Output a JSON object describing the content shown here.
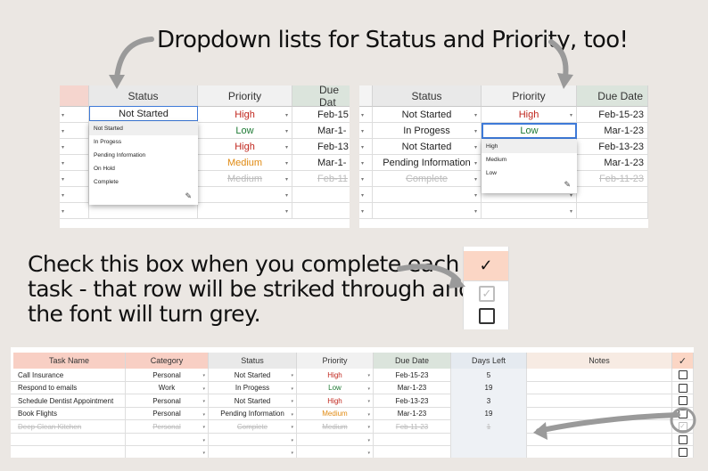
{
  "captions": {
    "top": "Dropdown lists for Status and Priority, too!",
    "middle": [
      "Check this box when you complete each",
      "task - that row will be striked through and",
      "the font will turn grey."
    ]
  },
  "status_sheet": {
    "headers": {
      "status": "Status",
      "priority": "Priority",
      "due": "Due Dat"
    },
    "active_value": "Not Started",
    "rows": [
      {
        "priority": "High",
        "due": "Feb-15"
      },
      {
        "priority": "Low",
        "due": "Mar-1-"
      },
      {
        "priority": "High",
        "due": "Feb-13"
      },
      {
        "priority": "Medium",
        "due": "Mar-1-"
      },
      {
        "priority": "Medium",
        "due": "Feb-11"
      }
    ],
    "options": [
      "Not Started",
      "In Progess",
      "Pending Information",
      "On Hold",
      "Complete"
    ],
    "selected_option": "Not Started"
  },
  "priority_sheet": {
    "headers": {
      "status": "Status",
      "priority": "Priority",
      "due": "Due Date"
    },
    "active_value": "Low",
    "rows": [
      {
        "status": "Not Started",
        "priority": "High",
        "due": "Feb-15-23"
      },
      {
        "status": "In Progess",
        "priority": "Low",
        "due": "Mar-1-23"
      },
      {
        "status": "Not Started",
        "priority": "",
        "due": "Feb-13-23"
      },
      {
        "status": "Pending Information",
        "priority": "",
        "due": "Mar-1-23"
      },
      {
        "status": "Complete",
        "priority": "",
        "due": "Feb-11-23"
      }
    ],
    "options": [
      "High",
      "Medium",
      "Low"
    ]
  },
  "checkbox_sample": {
    "header": "✓",
    "checked_mark": "✓"
  },
  "task_table": {
    "headers": {
      "task": "Task Name",
      "category": "Category",
      "status": "Status",
      "priority": "Priority",
      "due": "Due Date",
      "days": "Days Left",
      "notes": "Notes",
      "done": "✓"
    },
    "rows": [
      {
        "task": "Call Insurance",
        "category": "Personal",
        "status": "Not Started",
        "priority": "High",
        "priority_color": "#c0261d",
        "due": "Feb-15-23",
        "days": "5",
        "done": false
      },
      {
        "task": "Respond to emails",
        "category": "Work",
        "status": "In Progess",
        "priority": "Low",
        "priority_color": "#1d7a33",
        "due": "Mar-1-23",
        "days": "19",
        "done": false
      },
      {
        "task": "Schedule Dentist Appointment",
        "category": "Personal",
        "status": "Not Started",
        "priority": "High",
        "priority_color": "#c0261d",
        "due": "Feb-13-23",
        "days": "3",
        "done": false
      },
      {
        "task": "Book Flights",
        "category": "Personal",
        "status": "Pending Information",
        "priority": "Medium",
        "priority_color": "#e08a12",
        "due": "Mar-1-23",
        "days": "19",
        "done": false
      },
      {
        "task": "Deep Clean Kitchen",
        "category": "Personal",
        "status": "Complete",
        "priority": "Medium",
        "priority_color": "#bdbdbd",
        "due": "Feb-11-23",
        "days": "1",
        "done": true
      }
    ],
    "empty_rows": 3
  },
  "colors": {
    "background": "#ebe7e3",
    "header_pink": "#f8cfc4",
    "header_green": "#dbe4dc",
    "header_grey": "#e9e9e9",
    "done_orange": "#fbd6c5",
    "arrow_grey": "#9a9a9a",
    "high": "#c0261d",
    "low": "#1d7a33",
    "medium": "#e08a12",
    "struck": "#bdbdbd"
  }
}
